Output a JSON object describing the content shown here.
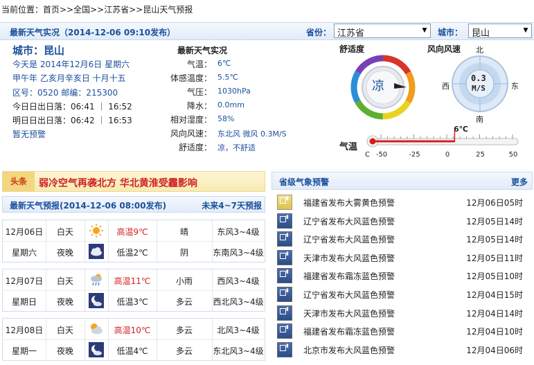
{
  "breadcrumb": "当前位置：首页>>全国>>江苏省>>昆山天气预报",
  "live": {
    "title": "最新天气实况（2014-12-06 09:10发布）",
    "province_label": "省份：",
    "province_value": "江苏省",
    "city_label": "城市：",
    "city_value": "昆山"
  },
  "info": {
    "city": "城市：昆山",
    "today": "今天是 2014年12月6日 星期六",
    "lunar": "甲午年 乙亥月辛亥日 十月十五",
    "codes": "区号：0520  邮编：215300",
    "today_sun": "今日日出日落：06:41 ｜ 16:52",
    "tomorrow_sun": "明日日出日落：06:42 ｜ 16:53",
    "alert": "暂无预警"
  },
  "obs": {
    "title": "最新天气实况",
    "rows": [
      {
        "k": "气温：",
        "v": "6℃"
      },
      {
        "k": "体感温度：",
        "v": "5.5℃"
      },
      {
        "k": "气压：",
        "v": "1030hPa"
      },
      {
        "k": "降水：",
        "v": "0.0mm"
      },
      {
        "k": "相对湿度：",
        "v": "58%"
      },
      {
        "k": "风向风速：",
        "v": "东北风 微风 0.3M/S"
      },
      {
        "k": "舒适度：",
        "v": "凉，不舒适"
      }
    ]
  },
  "comfort": {
    "label": "舒适度",
    "value": "凉"
  },
  "wind": {
    "label": "风向风速",
    "speed": "0.3",
    "unit": "M/S",
    "n": "北",
    "s": "南",
    "e": "东",
    "w": "西"
  },
  "thermo": {
    "label": "气温",
    "value_label": "6℃",
    "value": 6,
    "unit": "C",
    "ticks": [
      "-50",
      "-25",
      "0",
      "25",
      "50"
    ]
  },
  "headline": {
    "tag": "头条",
    "text": "弱冷空气再袭北方 华北黄淮受霾影响"
  },
  "forecast": {
    "title": "最新天气预报(2014-12-06 08:00发布)",
    "more": "未来4~7天预报",
    "days": [
      {
        "date": "12月06日",
        "weekday": "星期六",
        "day": {
          "label": "白天",
          "icon": "sun-icon",
          "temp": "高温9℃",
          "wx": "晴",
          "wind": "东风3~4级"
        },
        "night": {
          "label": "夜晚",
          "icon": "cloud-night-icon",
          "temp": "低温2℃",
          "wx": "阴",
          "wind": "东南风3~4级"
        }
      },
      {
        "date": "12月07日",
        "weekday": "星期日",
        "day": {
          "label": "白天",
          "icon": "rain-icon",
          "temp": "高温11℃",
          "wx": "小雨",
          "wind": "西风3~4级"
        },
        "night": {
          "label": "夜晚",
          "icon": "moon-cloud-icon",
          "temp": "低温3℃",
          "wx": "多云",
          "wind": "西北风3~4级"
        }
      },
      {
        "date": "12月08日",
        "weekday": "星期一",
        "day": {
          "label": "白天",
          "icon": "sun-cloud-icon",
          "temp": "高温10℃",
          "wx": "多云",
          "wind": "北风3~4级"
        },
        "night": {
          "label": "夜晚",
          "icon": "moon-cloud-icon",
          "temp": "低温4℃",
          "wx": "多云",
          "wind": "东北风3~4级"
        }
      }
    ]
  },
  "warnings": {
    "title": "省级气象预警",
    "more": "更多",
    "items": [
      {
        "text": "福建省发布大雾黄色预警",
        "time": "12月06日05时",
        "level": "yellow",
        "icon": "fog-warning-icon"
      },
      {
        "text": "辽宁省发布大风蓝色预警",
        "time": "12月05日14时",
        "level": "blue",
        "icon": "wind-warning-icon"
      },
      {
        "text": "辽宁省发布大风蓝色预警",
        "time": "12月05日14时",
        "level": "blue",
        "icon": "wind-warning-icon"
      },
      {
        "text": "天津市发布大风蓝色预警",
        "time": "12月05日11时",
        "level": "blue",
        "icon": "wind-warning-icon"
      },
      {
        "text": "福建省发布霜冻蓝色预警",
        "time": "12月05日10时",
        "level": "blue",
        "icon": "frost-warning-icon"
      },
      {
        "text": "辽宁省发布大风蓝色预警",
        "time": "12月04日15时",
        "level": "blue",
        "icon": "wind-warning-icon"
      },
      {
        "text": "天津市发布大风蓝色预警",
        "time": "12月04日14时",
        "level": "blue",
        "icon": "wind-warning-icon"
      },
      {
        "text": "福建省发布霜冻蓝色预警",
        "time": "12月04日10时",
        "level": "blue",
        "icon": "frost-warning-icon"
      },
      {
        "text": "北京市发布大风蓝色预警",
        "time": "12月04日06时",
        "level": "blue",
        "icon": "wind-warning-icon"
      }
    ]
  }
}
